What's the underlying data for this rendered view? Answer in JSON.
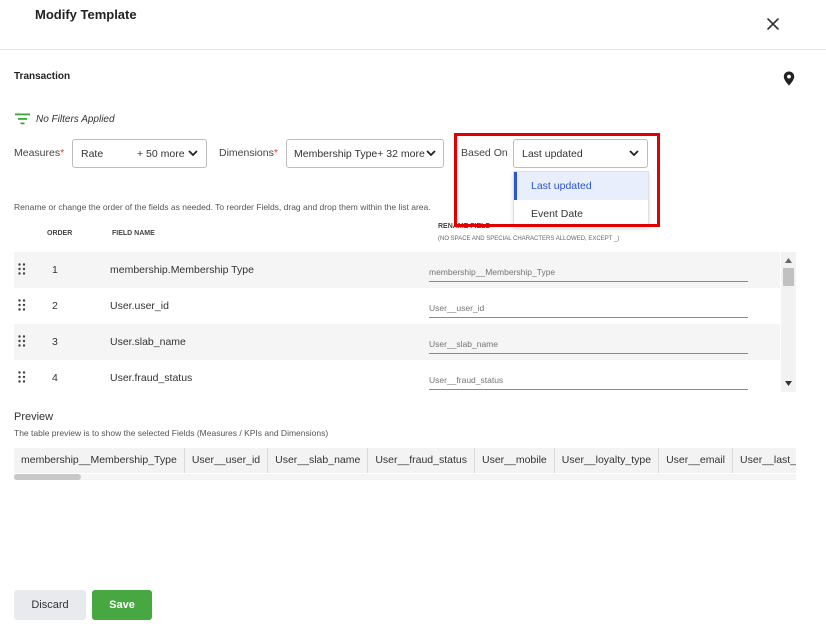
{
  "modal": {
    "title": "Modify Template"
  },
  "section": {
    "title": "Transaction"
  },
  "filters": {
    "text": "No Filters Applied"
  },
  "selectors": {
    "measures_label": "Measures",
    "measures_value": "Rate",
    "measures_more": "+ 50 more",
    "dimensions_label": "Dimensions",
    "dimensions_value": "Membership Type+ 32 more",
    "based_on_label": "Based On",
    "based_on_value": "Last updated",
    "required_mark": "*"
  },
  "dropdown": {
    "options": [
      "Last updated",
      "Event Date"
    ],
    "selected": "Last updated"
  },
  "instructions": "Rename or change the order of the fields as needed. To reorder Fields, drag and drop them within the list area.",
  "fields_table": {
    "header_order": "ORDER",
    "header_name": "FIELD NAME",
    "header_rename": "RENAME FIELD",
    "header_rename_note": "(NO SPACE AND SPECIAL CHARACTERS ALLOWED, EXCEPT _)",
    "rows": [
      {
        "order": "1",
        "name": "membership.Membership Type",
        "rename": "membership__Membership_Type"
      },
      {
        "order": "2",
        "name": "User.user_id",
        "rename": "User__user_id"
      },
      {
        "order": "3",
        "name": "User.slab_name",
        "rename": "User__slab_name"
      },
      {
        "order": "4",
        "name": "User.fraud_status",
        "rename": "User__fraud_status"
      }
    ]
  },
  "preview": {
    "title": "Preview",
    "subtitle": "The table preview is to show the selected Fields (Measures / KPIs and Dimensions)",
    "columns": [
      "membership__Membership_Type",
      "User__user_id",
      "User__slab_name",
      "User__fraud_status",
      "User__mobile",
      "User__loyalty_type",
      "User__email",
      "User__last_name"
    ]
  },
  "footer": {
    "discard_label": "Discard",
    "save_label": "Save"
  },
  "colors": {
    "accent_blue": "#2b56c9",
    "save_green": "#47a842",
    "highlight_red": "#e00000",
    "filter_icon_green": "#3aa63a"
  }
}
